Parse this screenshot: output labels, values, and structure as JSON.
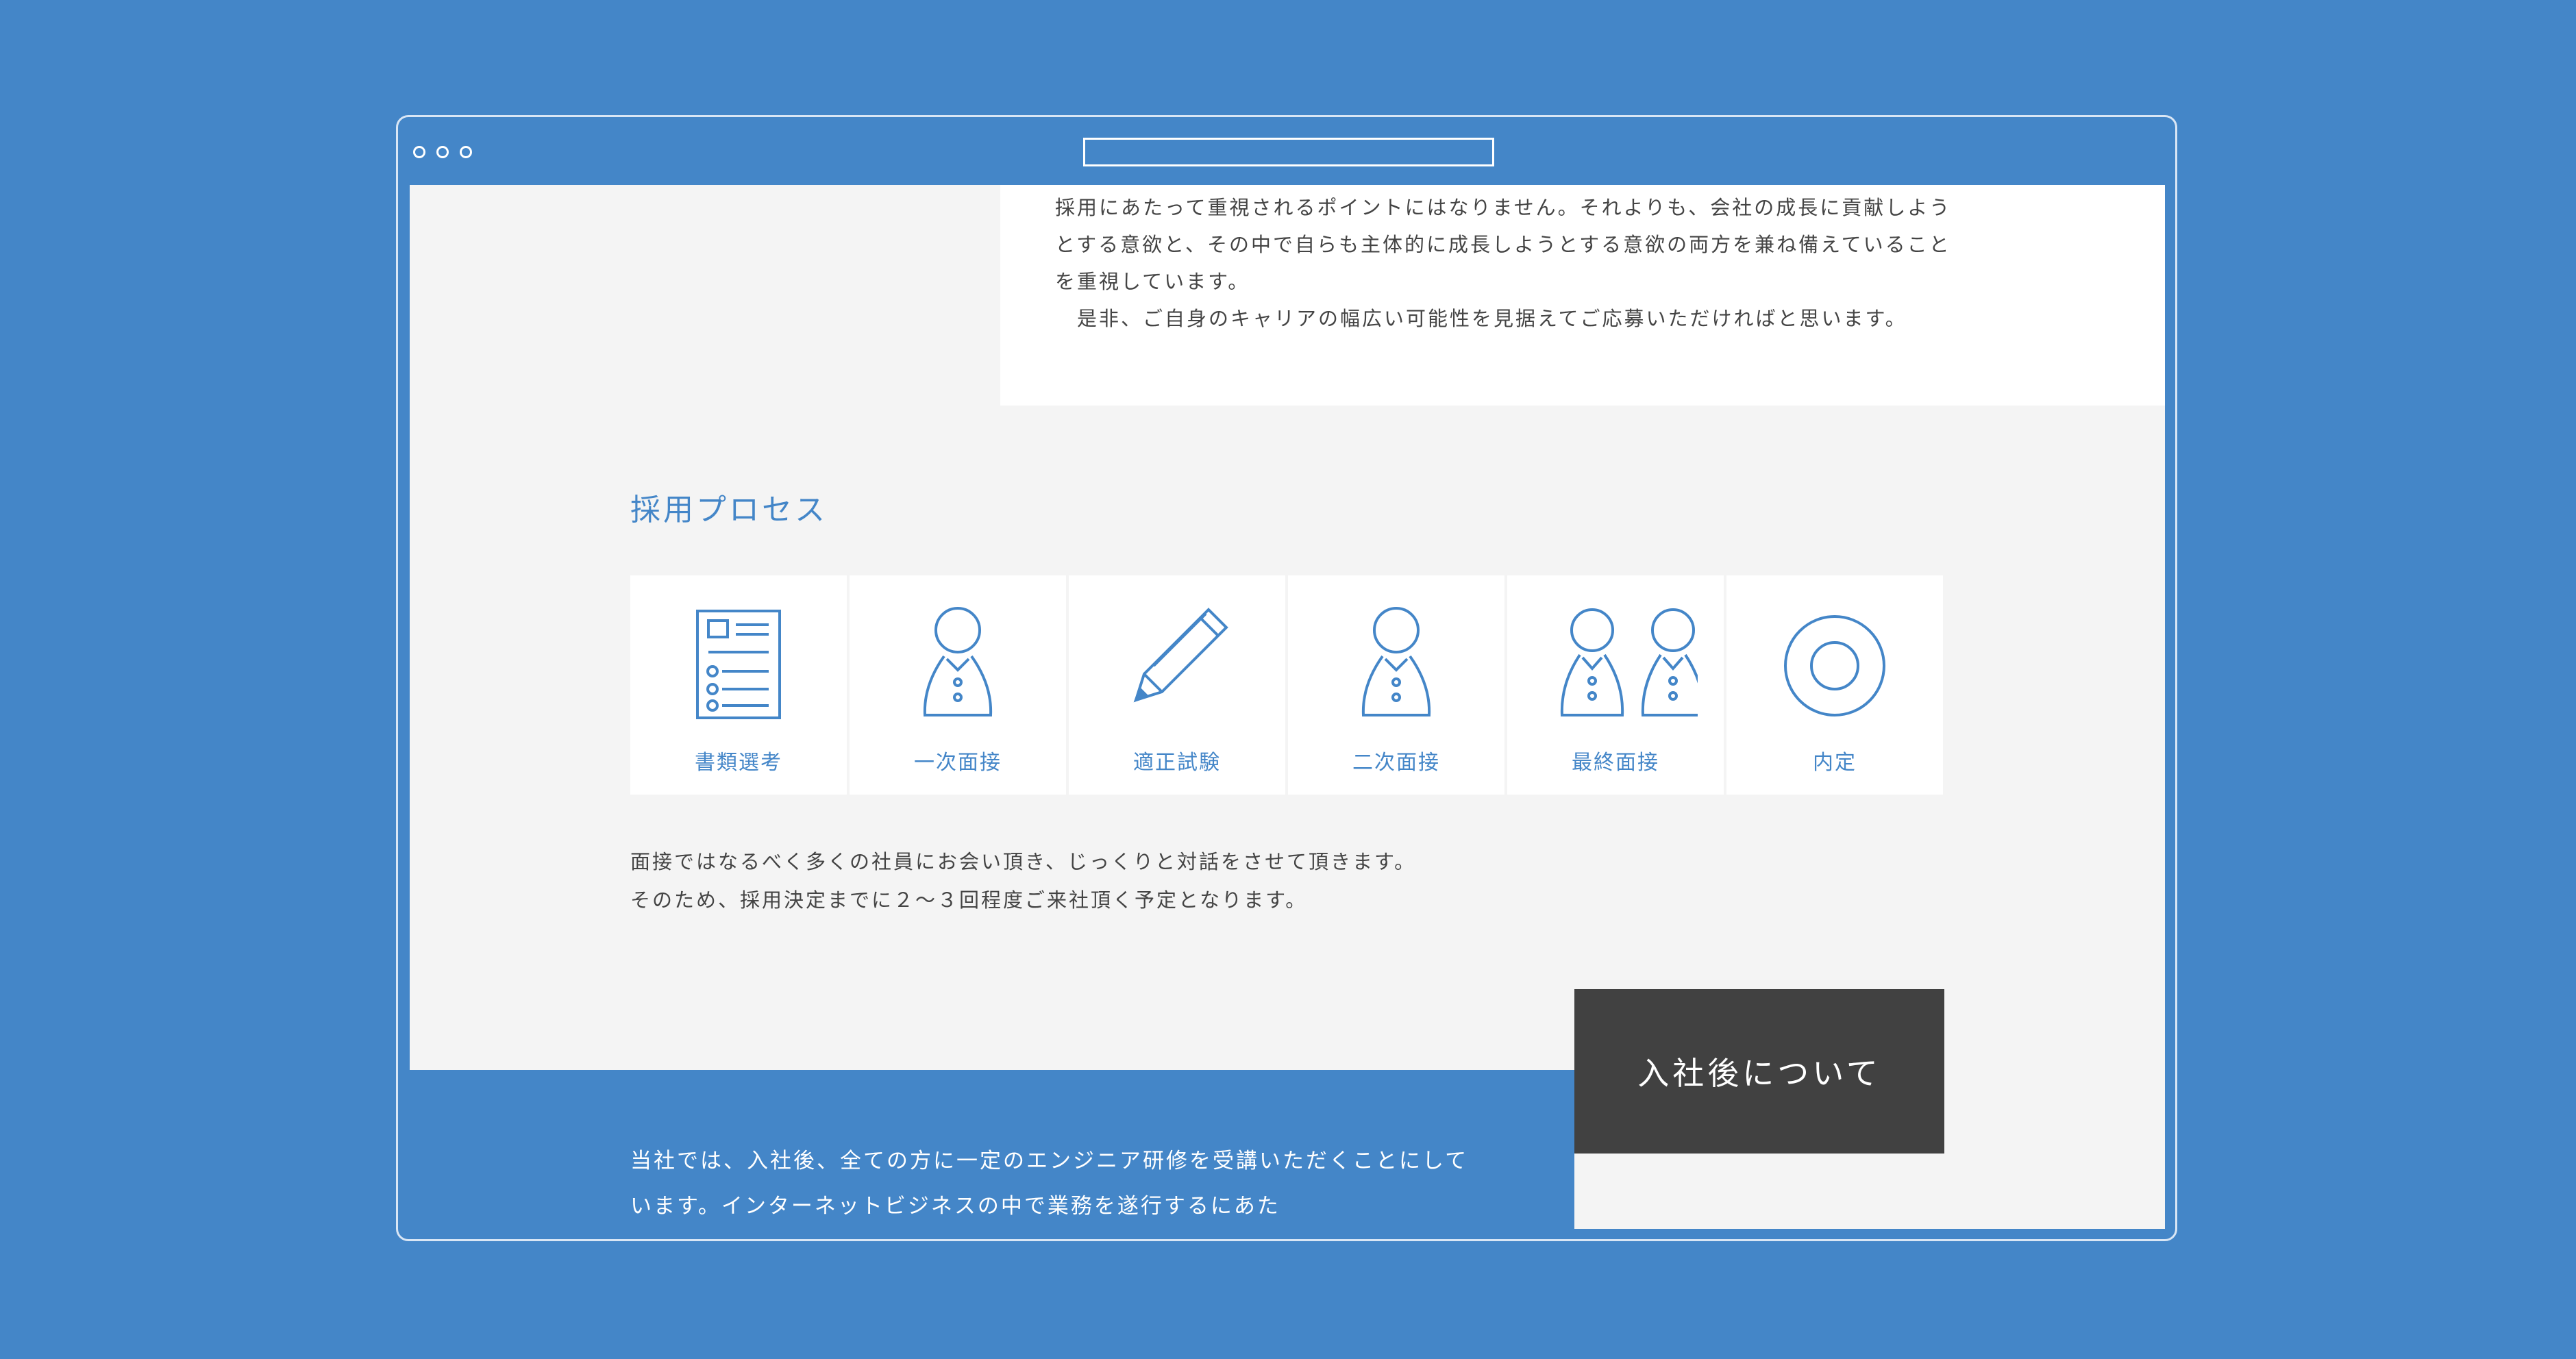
{
  "browser": {
    "window_controls": [
      "dot",
      "dot",
      "dot"
    ]
  },
  "intro": {
    "text": "採用にあたって重視されるポイントにはなりません。それよりも、会社の成長に貢献しようとする意欲と、その中で自らも主体的に成長しようとする意欲の両方を兼ね備えていることを重視しています。\n　是非、ご自身のキャリアの幅広い可能性を見据えてご応募いただければと思います。"
  },
  "process": {
    "title": "採用プロセス",
    "steps": [
      {
        "label": "書類選考",
        "icon": "document-icon"
      },
      {
        "label": "一次面接",
        "icon": "person-icon"
      },
      {
        "label": "適正試験",
        "icon": "pencil-icon"
      },
      {
        "label": "二次面接",
        "icon": "person-icon"
      },
      {
        "label": "最終面接",
        "icon": "two-persons-icon"
      },
      {
        "label": "内定",
        "icon": "circle-target-icon"
      }
    ],
    "note": "面接ではなるべく多くの社員にお会い頂き、じっくりと対話をさせて頂きます。\nそのため、採用決定までに２〜３回程度ご来社頂く予定となります。"
  },
  "after_joining": {
    "heading": "入社後について",
    "text": "当社では、入社後、全ての方に一定のエンジニア研修を受講いただくことにしています。インターネットビジネスの中で業務を遂行するにあた"
  },
  "colors": {
    "background": "#4486c8",
    "accent": "#4486c8",
    "dark_box": "#414141",
    "page": "#f4f4f4",
    "card": "#ffffff"
  }
}
